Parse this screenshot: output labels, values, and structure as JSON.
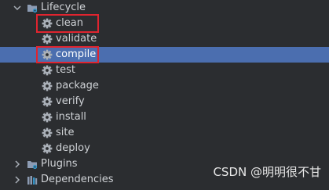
{
  "tree": {
    "lifecycle": {
      "label": "Lifecycle",
      "expanded": true,
      "icon": "maven-folder-icon",
      "goals": [
        {
          "label": "clean",
          "icon": "gear-icon",
          "highlighted": true,
          "selected": false
        },
        {
          "label": "validate",
          "icon": "gear-icon",
          "highlighted": false,
          "selected": false
        },
        {
          "label": "compile",
          "icon": "gear-icon",
          "highlighted": true,
          "selected": true
        },
        {
          "label": "test",
          "icon": "gear-icon",
          "highlighted": false,
          "selected": false
        },
        {
          "label": "package",
          "icon": "gear-icon",
          "highlighted": false,
          "selected": false
        },
        {
          "label": "verify",
          "icon": "gear-icon",
          "highlighted": false,
          "selected": false
        },
        {
          "label": "install",
          "icon": "gear-icon",
          "highlighted": false,
          "selected": false
        },
        {
          "label": "site",
          "icon": "gear-icon",
          "highlighted": false,
          "selected": false
        },
        {
          "label": "deploy",
          "icon": "gear-icon",
          "highlighted": false,
          "selected": false
        }
      ]
    },
    "plugins": {
      "label": "Plugins",
      "expanded": false,
      "icon": "maven-folder-icon"
    },
    "dependencies": {
      "label": "Dependencies",
      "expanded": false,
      "icon": "library-icon"
    }
  },
  "watermark": {
    "text": "CSDN @明明很不甘"
  },
  "colors": {
    "background": "#2b2d30",
    "selection": "#4b6eaf",
    "highlight_border": "#e0242f",
    "text": "#cfd2d6",
    "gear_icon": "#a9afb7"
  }
}
